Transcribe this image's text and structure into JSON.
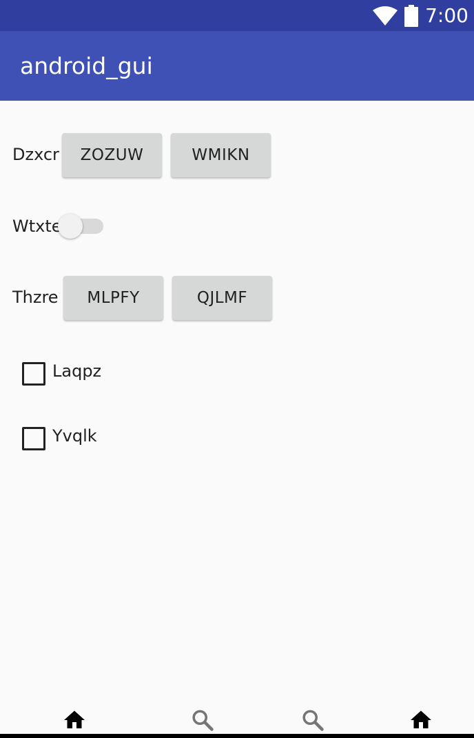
{
  "status_bar": {
    "time": "7:00",
    "icons": [
      "wifi-icon",
      "battery-icon"
    ]
  },
  "app_bar": {
    "title": "android_gui"
  },
  "content": {
    "row1": {
      "label": "Dzxcr",
      "buttons": [
        "ZOZUW",
        "WMIKN"
      ]
    },
    "switch_row": {
      "label": "Wtxte",
      "checked": false
    },
    "row2": {
      "label": "Thzre",
      "buttons": [
        "MLPFY",
        "QJLMF"
      ]
    },
    "checkboxes": [
      {
        "label": "Laqpz",
        "checked": false
      },
      {
        "label": "Yvqlk",
        "checked": false
      }
    ]
  },
  "bottom_nav": {
    "items": [
      "home-icon",
      "search-icon",
      "search-icon",
      "home-icon"
    ]
  },
  "colors": {
    "status_bar": "#303f9f",
    "app_bar": "#3f51b5",
    "button": "#d6d7d7",
    "background": "#fafafa"
  }
}
